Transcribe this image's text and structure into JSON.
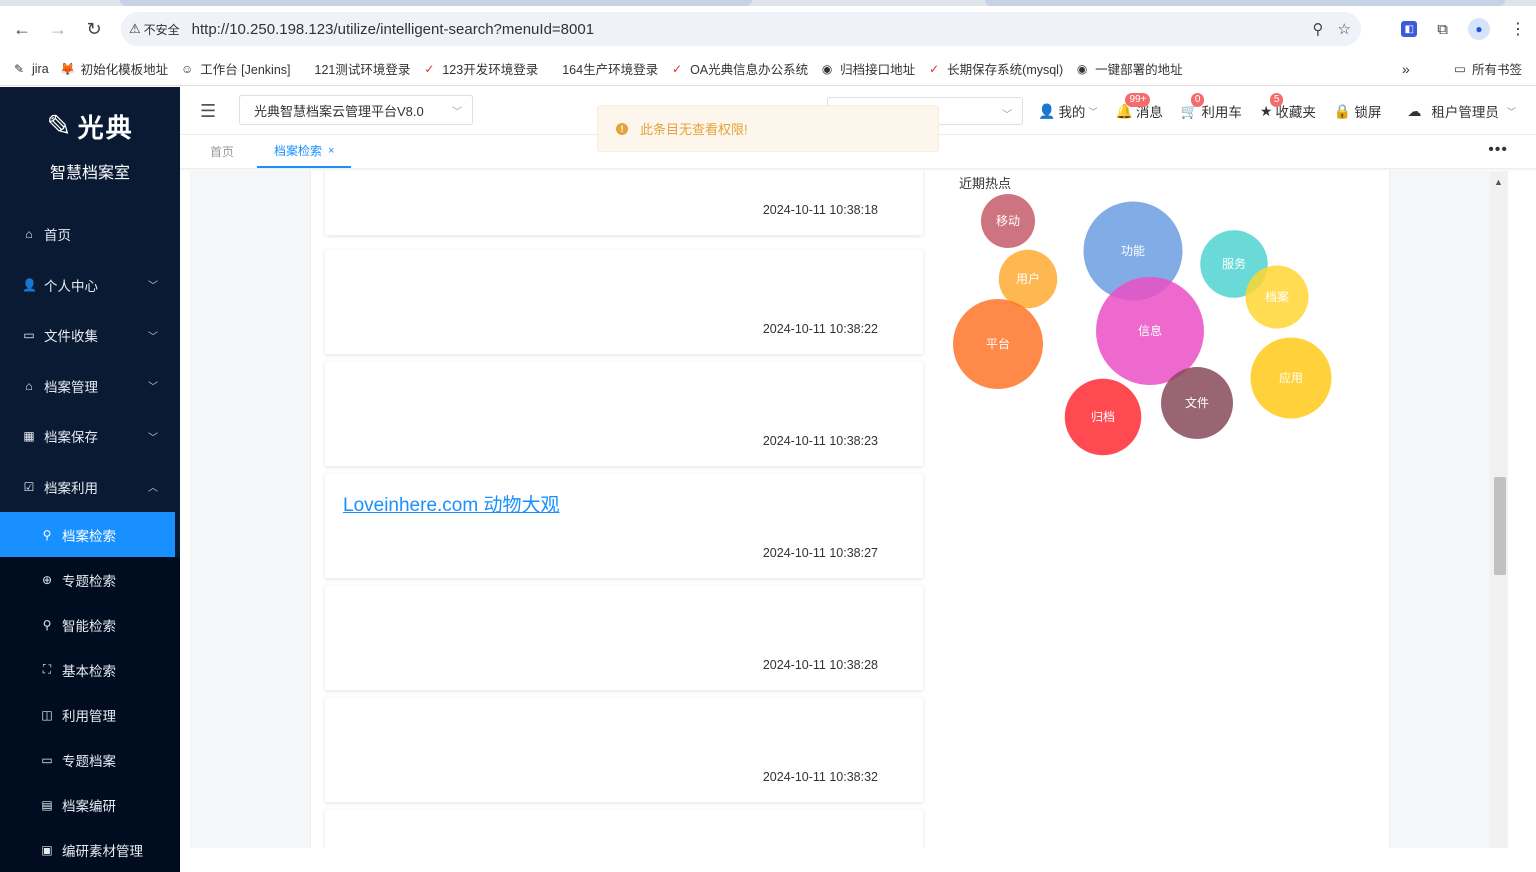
{
  "browser": {
    "insecure_label": "不安全",
    "url": "http://10.250.198.123/utilize/intelligent-search?menuId=8001"
  },
  "bookmarks": [
    {
      "label": "jira",
      "icon": "jira-icon"
    },
    {
      "label": "初始化模板地址",
      "icon": "gitlab-icon"
    },
    {
      "label": "工作台 [Jenkins]",
      "icon": "jenkins-icon"
    },
    {
      "label": "121测试环境登录",
      "icon": "blank-icon"
    },
    {
      "label": "123开发环境登录",
      "icon": "checkmark-icon"
    },
    {
      "label": "164生产环境登录",
      "icon": "blank-icon"
    },
    {
      "label": "OA光典信息办公系统",
      "icon": "oa-icon"
    },
    {
      "label": "归档接口地址",
      "icon": "globe-icon"
    },
    {
      "label": "长期保存系统(mysql)",
      "icon": "checkmark-icon"
    },
    {
      "label": "一键部署的地址",
      "icon": "globe-icon"
    }
  ],
  "bookmarks_folder": "所有书签",
  "sidebar": {
    "logo_text": "光典",
    "app_name": "智慧档案室",
    "items": [
      {
        "label": "首页",
        "icon": "home-icon",
        "expand": ""
      },
      {
        "label": "个人中心",
        "icon": "user-icon",
        "expand": "﹀"
      },
      {
        "label": "文件收集",
        "icon": "folder-icon",
        "expand": "﹀"
      },
      {
        "label": "档案管理",
        "icon": "bank-icon",
        "expand": "﹀"
      },
      {
        "label": "档案保存",
        "icon": "building-icon",
        "expand": "﹀"
      },
      {
        "label": "档案利用",
        "icon": "checklist-icon",
        "expand": "︿"
      }
    ],
    "sub_items": [
      {
        "label": "档案检索",
        "icon": "search-icon",
        "active": true
      },
      {
        "label": "专题检索",
        "icon": "compass-icon",
        "active": false
      },
      {
        "label": "智能检索",
        "icon": "search-icon",
        "active": false
      },
      {
        "label": "基本检索",
        "icon": "scan-icon",
        "active": false
      },
      {
        "label": "利用管理",
        "icon": "book-icon",
        "active": false
      },
      {
        "label": "专题档案",
        "icon": "folder-icon",
        "active": false
      },
      {
        "label": "档案编研",
        "icon": "document-icon",
        "active": false
      },
      {
        "label": "编研素材管理",
        "icon": "material-icon",
        "active": false
      }
    ]
  },
  "topbar": {
    "platform": "光典智慧档案云管理平台V8.0",
    "mine": "我的",
    "messages": "消息",
    "messages_badge": "99+",
    "cart": "利用车",
    "cart_badge": "0",
    "favorites": "收藏夹",
    "favorites_badge": "5",
    "lock": "锁屏",
    "tenant": "租户管理员"
  },
  "toast": {
    "message": "此条目无查看权限!"
  },
  "tabs": [
    {
      "label": "首页",
      "active": false
    },
    {
      "label": "档案检索",
      "active": true
    }
  ],
  "results": [
    {
      "title": "",
      "date": "2024-10-11 10:38:18"
    },
    {
      "title": "",
      "date": "2024-10-11 10:38:22"
    },
    {
      "title": "",
      "date": "2024-10-11 10:38:23"
    },
    {
      "title": "Loveinhere.com 动物大观",
      "date": "2024-10-11 10:38:27"
    },
    {
      "title": "",
      "date": "2024-10-11 10:38:28"
    },
    {
      "title": "",
      "date": "2024-10-11 10:38:32"
    },
    {
      "title": "",
      "date": ""
    }
  ],
  "hot": {
    "title": "近期热点",
    "bubbles": [
      {
        "label": "移动",
        "color": "#c45c6a",
        "size": 1.2
      },
      {
        "label": "功能",
        "color": "#6c9de0",
        "size": 2.2
      },
      {
        "label": "服务",
        "color": "#4fd4d0",
        "size": 1.5
      },
      {
        "label": "用户",
        "color": "#ffaa33",
        "size": 1.3
      },
      {
        "label": "档案",
        "color": "#ffd633",
        "size": 1.4
      },
      {
        "label": "信息",
        "color": "#ea4fc6",
        "size": 2.4
      },
      {
        "label": "平台",
        "color": "#ff7428",
        "size": 2.0
      },
      {
        "label": "应用",
        "color": "#ffc919",
        "size": 1.8
      },
      {
        "label": "文件",
        "color": "#874a5a",
        "size": 1.6
      },
      {
        "label": "归档",
        "color": "#ff2a33",
        "size": 1.7
      }
    ]
  }
}
